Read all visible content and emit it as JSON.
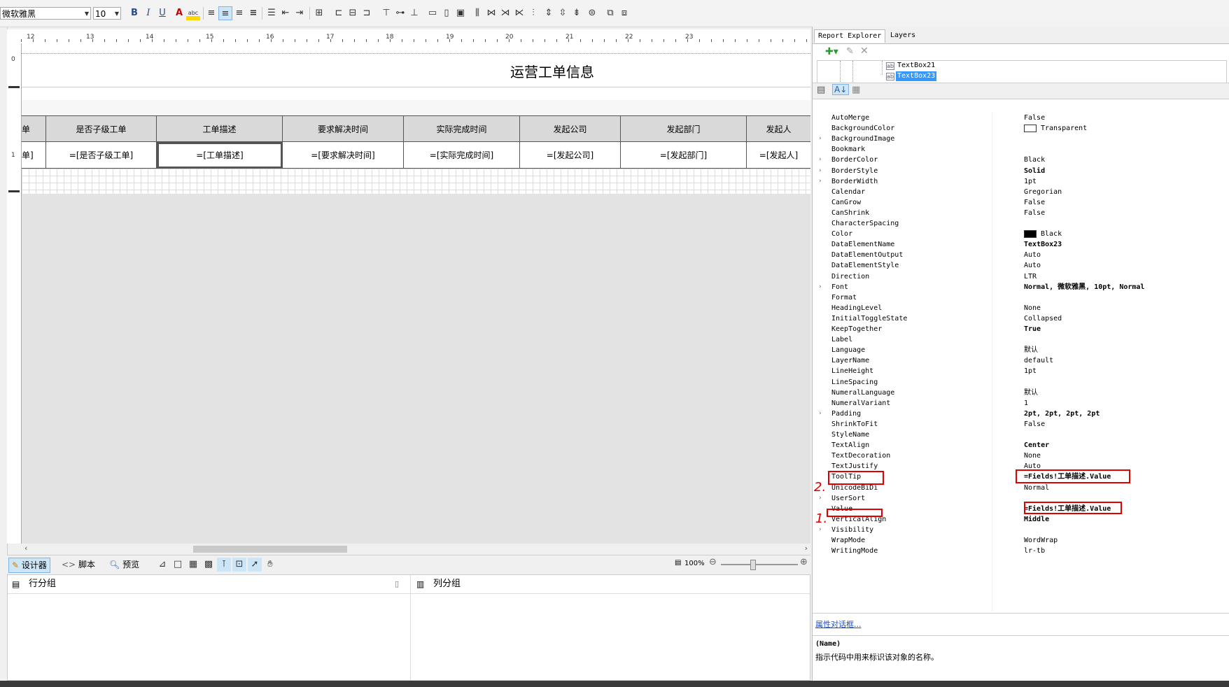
{
  "toolbar": {
    "font_name": "微软雅黑",
    "font_size": "10",
    "bold": "B",
    "italic": "I",
    "underline": "U",
    "font_color": "A",
    "highlight": "abc"
  },
  "report": {
    "title": "运营工单信息",
    "headers": [
      "单",
      "是否子级工单",
      "工单描述",
      "要求解决时间",
      "实际完成时间",
      "发起公司",
      "发起部门",
      "发起人"
    ],
    "details": [
      "单]",
      "=[是否子级工单]",
      "=[工单描述]",
      "=[要求解决时间]",
      "=[实际完成时间]",
      "=[发起公司]",
      "=[发起部门]",
      "=[发起人]"
    ],
    "selected_column": 2
  },
  "ruler": {
    "marks": [
      "12",
      "13",
      "14",
      "15",
      "16",
      "17",
      "18",
      "19",
      "20",
      "21",
      "22",
      "23"
    ],
    "vmarks": [
      "0",
      "1"
    ]
  },
  "tabs": {
    "designer": "设计器",
    "script": "脚本",
    "preview": "预览",
    "zoom": "100%"
  },
  "groups": {
    "row_group": "行分组",
    "col_group": "列分组"
  },
  "panel": {
    "tab_explorer": "Report Explorer",
    "tab_layers": "Layers",
    "tree": [
      "TextBox21",
      "TextBox23"
    ],
    "selected_tree_item": "TextBox23",
    "properties": [
      {
        "name": "AutoMerge",
        "value": "False"
      },
      {
        "name": "BackgroundColor",
        "value": "Transparent",
        "swatch": "#ffffff"
      },
      {
        "name": "BackgroundImage",
        "value": "",
        "expand": true
      },
      {
        "name": "Bookmark",
        "value": ""
      },
      {
        "name": "BorderColor",
        "value": "Black",
        "expand": true
      },
      {
        "name": "BorderStyle",
        "value": "Solid",
        "expand": true,
        "bold": true
      },
      {
        "name": "BorderWidth",
        "value": "1pt",
        "expand": true
      },
      {
        "name": "Calendar",
        "value": "Gregorian"
      },
      {
        "name": "CanGrow",
        "value": "False"
      },
      {
        "name": "CanShrink",
        "value": "False"
      },
      {
        "name": "CharacterSpacing",
        "value": ""
      },
      {
        "name": "Color",
        "value": "Black",
        "swatch": "#000000"
      },
      {
        "name": "DataElementName",
        "value": "TextBox23",
        "bold": true
      },
      {
        "name": "DataElementOutput",
        "value": "Auto"
      },
      {
        "name": "DataElementStyle",
        "value": "Auto"
      },
      {
        "name": "Direction",
        "value": "LTR"
      },
      {
        "name": "Font",
        "value": "Normal, 微软雅黑, 10pt, Normal",
        "expand": true,
        "bold": true
      },
      {
        "name": "Format",
        "value": ""
      },
      {
        "name": "HeadingLevel",
        "value": "None"
      },
      {
        "name": "InitialToggleState",
        "value": "Collapsed"
      },
      {
        "name": "KeepTogether",
        "value": "True",
        "bold": true
      },
      {
        "name": "Label",
        "value": ""
      },
      {
        "name": "Language",
        "value": "默认"
      },
      {
        "name": "LayerName",
        "value": "default"
      },
      {
        "name": "LineHeight",
        "value": "1pt"
      },
      {
        "name": "LineSpacing",
        "value": ""
      },
      {
        "name": "NumeralLanguage",
        "value": "默认"
      },
      {
        "name": "NumeralVariant",
        "value": "1"
      },
      {
        "name": "Padding",
        "value": "2pt, 2pt, 2pt, 2pt",
        "expand": true,
        "bold": true
      },
      {
        "name": "ShrinkToFit",
        "value": "False"
      },
      {
        "name": "StyleName",
        "value": ""
      },
      {
        "name": "TextAlign",
        "value": "Center",
        "bold": true
      },
      {
        "name": "TextDecoration",
        "value": "None"
      },
      {
        "name": "TextJustify",
        "value": "Auto"
      },
      {
        "name": "ToolTip",
        "value": "=Fields!工单描述.Value",
        "bold": true,
        "highlight": true
      },
      {
        "name": "UnicodeBiDi",
        "value": "Normal"
      },
      {
        "name": "UserSort",
        "value": "",
        "expand": true
      },
      {
        "name": "Value",
        "value": "=Fields!工单描述.Value",
        "bold": true,
        "highlight": true
      },
      {
        "name": "VerticalAlign",
        "value": "Middle",
        "bold": true
      },
      {
        "name": "Visibility",
        "value": "",
        "expand": true
      },
      {
        "name": "WrapMode",
        "value": "WordWrap"
      },
      {
        "name": "WritingMode",
        "value": "lr-tb"
      }
    ],
    "dialog_link": "属性对话框...",
    "desc_title": "(Name)",
    "desc_text": "指示代码中用来标识该对象的名称。"
  },
  "annotations": {
    "mark_tooltip": "2.",
    "mark_value": "1."
  },
  "colors": {
    "accent": "#3399ff",
    "highlight_box": "#e00000",
    "header_fill": "#d9d9d9"
  }
}
